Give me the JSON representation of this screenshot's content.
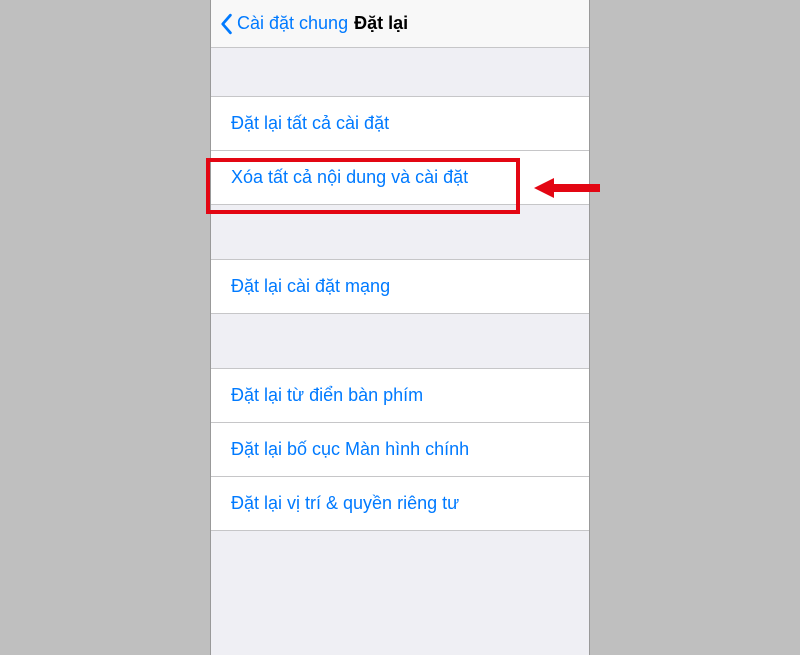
{
  "nav": {
    "back_label": "Cài đặt chung",
    "title": "Đặt lại"
  },
  "group1": {
    "items": [
      {
        "label": "Đặt lại tất cả cài đặt"
      },
      {
        "label": "Xóa tất cả nội dung và cài đặt"
      }
    ]
  },
  "group2": {
    "items": [
      {
        "label": "Đặt lại cài đặt mạng"
      }
    ]
  },
  "group3": {
    "items": [
      {
        "label": "Đặt lại từ điển bàn phím"
      },
      {
        "label": "Đặt lại bố cục Màn hình chính"
      },
      {
        "label": "Đặt lại vị trí & quyền riêng tư"
      }
    ]
  },
  "colors": {
    "accent": "#007aff",
    "highlight": "#e30613",
    "background": "#efeff4"
  }
}
